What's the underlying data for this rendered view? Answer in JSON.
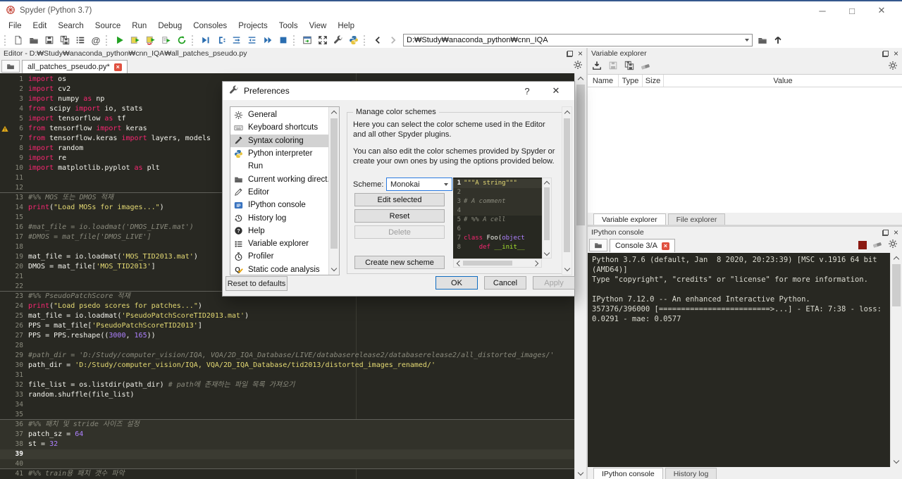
{
  "window": {
    "title": "Spyder (Python 3.7)"
  },
  "menus": [
    "File",
    "Edit",
    "Search",
    "Source",
    "Run",
    "Debug",
    "Consoles",
    "Projects",
    "Tools",
    "View",
    "Help"
  ],
  "toolbar": {
    "path": "D:₩Study₩anaconda_python₩cnn_IQA"
  },
  "editor": {
    "title": "Editor - D:₩Study₩anaconda_python₩cnn_IQA₩all_patches_pseudo.py",
    "tab": "all_patches_pseudo.py*",
    "lines": [
      {
        "n": 1,
        "t": [
          [
            "import",
            "k"
          ],
          [
            " os",
            "t"
          ]
        ]
      },
      {
        "n": 2,
        "t": [
          [
            "import",
            "k"
          ],
          [
            " cv2",
            "t"
          ]
        ]
      },
      {
        "n": 3,
        "t": [
          [
            "import",
            "k"
          ],
          [
            " numpy ",
            "t"
          ],
          [
            "as",
            "k"
          ],
          [
            " np",
            "t"
          ]
        ]
      },
      {
        "n": 4,
        "t": [
          [
            "from",
            "k"
          ],
          [
            " scipy ",
            "t"
          ],
          [
            "import",
            "k"
          ],
          [
            " io, stats",
            "t"
          ]
        ]
      },
      {
        "n": 5,
        "t": [
          [
            "import",
            "k"
          ],
          [
            " tensorflow ",
            "t"
          ],
          [
            "as",
            "k"
          ],
          [
            " tf",
            "t"
          ]
        ]
      },
      {
        "n": 6,
        "warn": 1,
        "t": [
          [
            "from",
            "k"
          ],
          [
            " tensorflow ",
            "t"
          ],
          [
            "import",
            "k"
          ],
          [
            " keras",
            "t"
          ]
        ]
      },
      {
        "n": 7,
        "t": [
          [
            "from",
            "k"
          ],
          [
            " tensorflow.keras ",
            "t"
          ],
          [
            "import",
            "k"
          ],
          [
            " layers, models",
            "t"
          ]
        ]
      },
      {
        "n": 8,
        "t": [
          [
            "import",
            "k"
          ],
          [
            " random",
            "t"
          ]
        ]
      },
      {
        "n": 9,
        "t": [
          [
            "import",
            "k"
          ],
          [
            " re",
            "t"
          ]
        ]
      },
      {
        "n": 10,
        "t": [
          [
            "import",
            "k"
          ],
          [
            " matplotlib.pyplot ",
            "t"
          ],
          [
            "as",
            "k"
          ],
          [
            " plt",
            "t"
          ]
        ]
      },
      {
        "n": 11,
        "t": []
      },
      {
        "n": 12,
        "sep": 1,
        "t": []
      },
      {
        "n": 13,
        "t": [
          [
            "#%% MOS 또는 DMOS 적재",
            "c"
          ]
        ]
      },
      {
        "n": 14,
        "t": [
          [
            "print",
            "k"
          ],
          [
            "(",
            "t"
          ],
          [
            "\"Load MOSs for images...\"",
            "s"
          ],
          [
            ")",
            "t"
          ]
        ]
      },
      {
        "n": 15,
        "t": []
      },
      {
        "n": 16,
        "t": [
          [
            "#mat_file = io.loadmat('DMOS_LIVE.mat')",
            "c"
          ]
        ]
      },
      {
        "n": 17,
        "t": [
          [
            "#DMOS = mat_file['DMOS_LIVE']",
            "c"
          ]
        ]
      },
      {
        "n": 18,
        "t": []
      },
      {
        "n": 19,
        "t": [
          [
            "mat_file = io.loadmat(",
            "t"
          ],
          [
            "'MOS_TID2013.mat'",
            "s"
          ],
          [
            ")",
            "t"
          ]
        ]
      },
      {
        "n": 20,
        "t": [
          [
            "DMOS = mat_file[",
            "t"
          ],
          [
            "'MOS_TID2013'",
            "s"
          ],
          [
            "]",
            "t"
          ]
        ]
      },
      {
        "n": 21,
        "t": []
      },
      {
        "n": 22,
        "sep": 1,
        "t": []
      },
      {
        "n": 23,
        "t": [
          [
            "#%% PseudoPatchScore 적재",
            "c"
          ]
        ]
      },
      {
        "n": 24,
        "t": [
          [
            "print",
            "k"
          ],
          [
            "(",
            "t"
          ],
          [
            "\"Load psedo scores for patches...\"",
            "s"
          ],
          [
            ")",
            "t"
          ]
        ]
      },
      {
        "n": 25,
        "t": [
          [
            "mat_file = io.loadmat(",
            "t"
          ],
          [
            "'PseudoPatchScoreTID2013.mat'",
            "s"
          ],
          [
            ")",
            "t"
          ]
        ]
      },
      {
        "n": 26,
        "t": [
          [
            "PPS = mat_file[",
            "t"
          ],
          [
            "'PseudoPatchScoreTID2013'",
            "s"
          ],
          [
            "]",
            "t"
          ]
        ]
      },
      {
        "n": 27,
        "t": [
          [
            "PPS = PPS.reshape((",
            "t"
          ],
          [
            "3000",
            "num"
          ],
          [
            ", ",
            "t"
          ],
          [
            "165",
            "num"
          ],
          [
            "))",
            "t"
          ]
        ]
      },
      {
        "n": 28,
        "t": []
      },
      {
        "n": 29,
        "t": [
          [
            "#path_dir = 'D:/Study/computer_vision/IQA, VQA/2D_IQA_Database/LIVE/databaserelease2/databaserelease2/all_distorted_images/'",
            "c"
          ]
        ]
      },
      {
        "n": 30,
        "t": [
          [
            "path_dir = ",
            "t"
          ],
          [
            "'D:/Study/computer_vision/IQA, VQA/2D_IQA_Database/tid2013/distorted_images_renamed/'",
            "s"
          ]
        ]
      },
      {
        "n": 31,
        "t": []
      },
      {
        "n": 32,
        "t": [
          [
            "file_list = os.listdir(path_dir) ",
            "t"
          ],
          [
            "# path에 존재하는 파일 목록 가져오기",
            "c"
          ]
        ]
      },
      {
        "n": 33,
        "t": [
          [
            "random.shuffle(file_list)",
            "t"
          ]
        ]
      },
      {
        "n": 34,
        "t": []
      },
      {
        "n": 35,
        "sep": 1,
        "t": []
      },
      {
        "n": 36,
        "cell": 1,
        "t": [
          [
            "#%% 패치 및 stride 사이즈 설정",
            "c"
          ]
        ]
      },
      {
        "n": 37,
        "cell": 1,
        "t": [
          [
            "patch_sz = ",
            "t"
          ],
          [
            "64",
            "num"
          ]
        ]
      },
      {
        "n": 38,
        "cell": 1,
        "t": [
          [
            "st = ",
            "t"
          ],
          [
            "32",
            "num"
          ]
        ]
      },
      {
        "n": 39,
        "cell": 1,
        "cur": 1,
        "t": []
      },
      {
        "n": 40,
        "cell": 1,
        "sep": 1,
        "t": []
      },
      {
        "n": 41,
        "t": [
          [
            "#%% train용 패치 갯수 파악",
            "c"
          ]
        ]
      }
    ]
  },
  "variable_explorer": {
    "title": "Variable explorer",
    "columns": [
      "Name",
      "Type",
      "Size",
      "Value"
    ],
    "rows": [],
    "tabs": [
      "Variable explorer",
      "File explorer"
    ],
    "active_tab": "Variable explorer"
  },
  "console": {
    "title": "IPython console",
    "tab": "Console 3/A",
    "lines": [
      "Python 3.7.6 (default, Jan  8 2020, 20:23:39) [MSC v.1916 64 bit",
      "(AMD64)]",
      "Type \"copyright\", \"credits\" or \"license\" for more information.",
      "",
      "IPython 7.12.0 -- An enhanced Interactive Python.",
      "357376/396000 [=========================>...] - ETA: 7:38 - loss:",
      "0.0291 - mae: 0.0577"
    ],
    "tabs": [
      "IPython console",
      "History log"
    ],
    "active_tab": "IPython console"
  },
  "dialog": {
    "title": "Preferences",
    "sidebar": [
      {
        "icon": "gear",
        "label": "General"
      },
      {
        "icon": "keyboard",
        "label": "Keyboard shortcuts"
      },
      {
        "icon": "dropper",
        "label": "Syntax coloring",
        "selected": true
      },
      {
        "icon": "python",
        "label": "Python interpreter"
      },
      {
        "icon": "run",
        "label": "Run"
      },
      {
        "icon": "folder",
        "label": "Current working direct..."
      },
      {
        "icon": "pencil",
        "label": "Editor"
      },
      {
        "icon": "ip",
        "label": "IPython console"
      },
      {
        "icon": "history",
        "label": "History log"
      },
      {
        "icon": "help",
        "label": "Help"
      },
      {
        "icon": "varlist",
        "label": "Variable explorer"
      },
      {
        "icon": "profiler",
        "label": "Profiler"
      },
      {
        "icon": "staticq",
        "label": "Static code analysis"
      }
    ],
    "panel": {
      "group_title": "Manage color schemes",
      "p1": "Here you can select the color scheme used in the Editor and all other Spyder plugins.",
      "p2": "You can also edit the color schemes provided by Spyder or create your own ones by using the options provided below.",
      "scheme_label": "Scheme:",
      "scheme_value": "Monokai",
      "buttons": {
        "edit": "Edit selected",
        "reset": "Reset",
        "delete": "Delete",
        "create": "Create new scheme"
      },
      "preview": [
        {
          "n": 1,
          "cell": 1,
          "cur": 1,
          "t": [
            [
              "\"\"\"A string\"\"\"",
              "s"
            ]
          ]
        },
        {
          "n": 2,
          "cell": 1,
          "t": []
        },
        {
          "n": 3,
          "cell": 1,
          "t": [
            [
              "# A comment",
              "c"
            ]
          ]
        },
        {
          "n": 4,
          "cell": 1,
          "t": []
        },
        {
          "n": 5,
          "t": [
            [
              "# %% A cell",
              "c"
            ]
          ]
        },
        {
          "n": 6,
          "t": []
        },
        {
          "n": 7,
          "t": [
            [
              "class",
              "k"
            ],
            [
              " Foo(",
              "t"
            ],
            [
              "object",
              "num"
            ]
          ]
        },
        {
          "n": 8,
          "t": [
            [
              "    ",
              "t"
            ],
            [
              "def",
              "k"
            ],
            [
              " ",
              "t"
            ],
            [
              "__init__",
              "f"
            ]
          ]
        }
      ]
    },
    "footer": {
      "reset_defaults": "Reset to defaults",
      "ok": "OK",
      "cancel": "Cancel",
      "apply": "Apply"
    }
  },
  "colors": {
    "accent_blue": "#2a6db0",
    "run_green": "#21a121",
    "keyword_pink": "#f92672",
    "string_yellow": "#e6db74",
    "number_purple": "#ae81ff",
    "comment_gray": "#75715e",
    "editor_bg": "#282822",
    "tab_close_red": "#e0503f",
    "console_busy_red": "#8b1a12"
  }
}
